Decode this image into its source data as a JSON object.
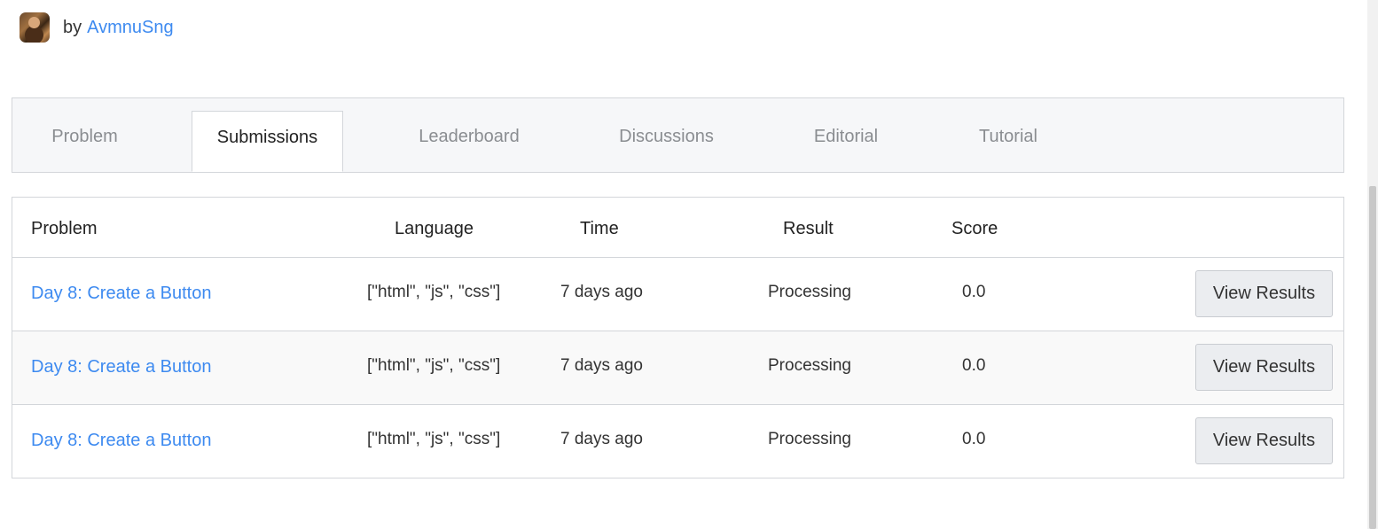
{
  "author": {
    "by_label": "by",
    "name": "AvmnuSng"
  },
  "tabs": [
    {
      "label": "Problem",
      "active": false
    },
    {
      "label": "Submissions",
      "active": true
    },
    {
      "label": "Leaderboard",
      "active": false
    },
    {
      "label": "Discussions",
      "active": false
    },
    {
      "label": "Editorial",
      "active": false
    },
    {
      "label": "Tutorial",
      "active": false
    }
  ],
  "table": {
    "headers": {
      "problem": "Problem",
      "language": "Language",
      "time": "Time",
      "result": "Result",
      "score": "Score"
    },
    "rows": [
      {
        "problem": "Day 8: Create a Button",
        "language": "[\"html\", \"js\", \"css\"]",
        "time": "7 days ago",
        "result": "Processing",
        "score": "0.0",
        "action": "View Results"
      },
      {
        "problem": "Day 8: Create a Button",
        "language": "[\"html\", \"js\", \"css\"]",
        "time": "7 days ago",
        "result": "Processing",
        "score": "0.0",
        "action": "View Results"
      },
      {
        "problem": "Day 8: Create a Button",
        "language": "[\"html\", \"js\", \"css\"]",
        "time": "7 days ago",
        "result": "Processing",
        "score": "0.0",
        "action": "View Results"
      }
    ]
  },
  "colors": {
    "link": "#3d8af0",
    "tab_bar_bg": "#f6f7f9",
    "border": "#d3d6da",
    "button_bg": "#ebedf0"
  }
}
